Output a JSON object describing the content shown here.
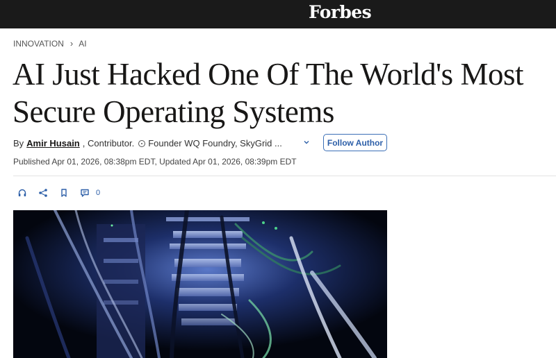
{
  "header": {
    "logo": "Forbes"
  },
  "breadcrumb": {
    "section": "INNOVATION",
    "subsection": "AI"
  },
  "article": {
    "title": "AI Just Hacked One Of The World's Most Secure Operating Systems",
    "byline": {
      "prefix": "By",
      "author": "Amir Husain",
      "role": ", Contributor.",
      "description": "Founder WQ Foundry, SkyGrid ..."
    },
    "follow_label": "Follow Author",
    "published": "Published Apr 01, 2026, 08:38pm EDT, Updated Apr 01, 2026, 08:39pm EDT"
  },
  "actions": {
    "icons": [
      "headphones-icon",
      "share-icon",
      "bookmark-icon",
      "comment-icon"
    ],
    "comment_count": "0"
  },
  "colors": {
    "topbar": "#1a1a1a",
    "accent": "#2d5fa8",
    "text": "#181716"
  },
  "hero": {
    "description_icon": "server-rack-image"
  }
}
